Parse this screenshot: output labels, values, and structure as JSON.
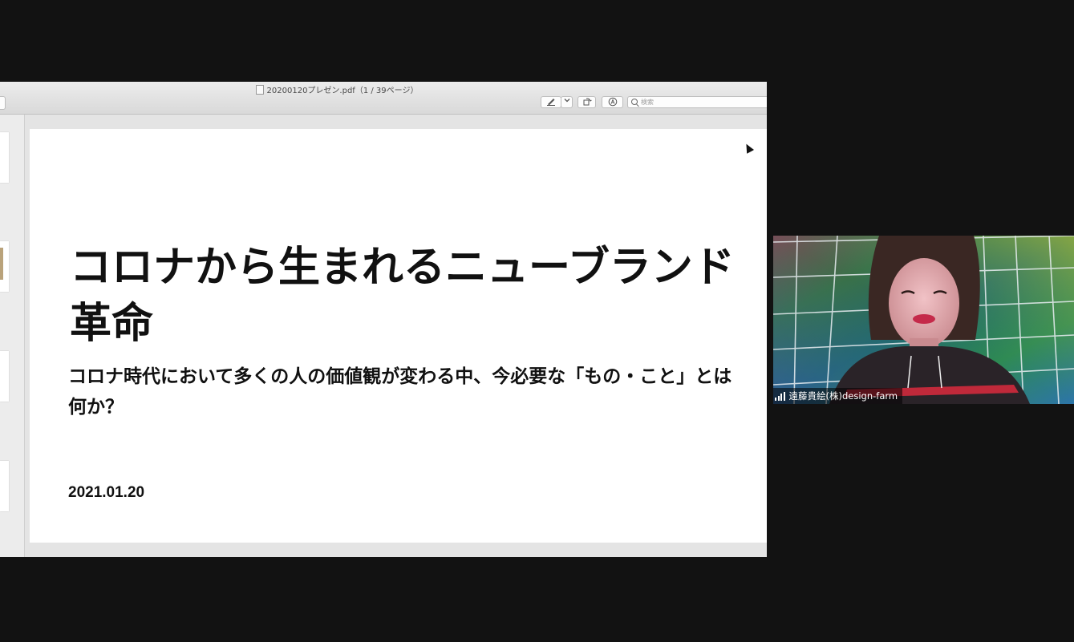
{
  "window": {
    "title": "20200120プレゼン.pdf（1 / 39ページ）"
  },
  "toolbar": {
    "search_placeholder": "検索",
    "markup_icon": "pen-icon",
    "menu_icon": "chevron-down-icon",
    "rotate_icon": "rotate-icon",
    "annotate_icon": "markup-circle-icon",
    "search_icon": "search-icon"
  },
  "slide": {
    "title": "コロナから生まれるニューブランド革命",
    "subtitle": "コロナ時代において多くの人の価値観が変わる中、今必要な「もの・こと」とは何か？",
    "date": "2021.01.20"
  },
  "participant": {
    "name": "遠藤貴絵(株)design-farm",
    "signal_icon": "signal-strength-icon"
  },
  "colors": {
    "background": "#121212",
    "slide_text": "#111111",
    "label_text": "#ffffff"
  }
}
